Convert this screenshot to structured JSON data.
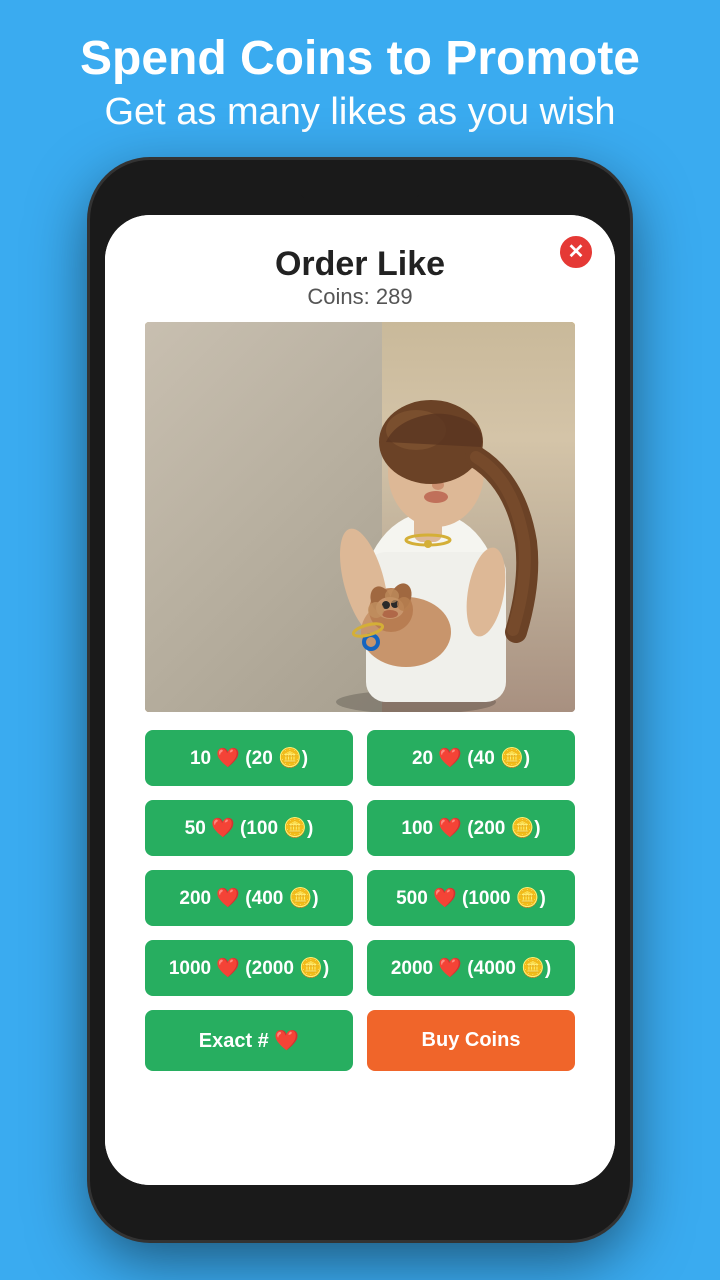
{
  "header": {
    "title": "Spend Coins to Promote",
    "subtitle": "Get as many likes as you wish"
  },
  "modal": {
    "title": "Order Like",
    "coins_label": "Coins: 289",
    "close_label": "✕"
  },
  "order_buttons": [
    {
      "likes": "10",
      "coins": "20",
      "label": "10 ❤️ (20 🪙)"
    },
    {
      "likes": "20",
      "coins": "40",
      "label": "20 ❤️ (40 🪙)"
    },
    {
      "likes": "50",
      "coins": "100",
      "label": "50 ❤️ (100 🪙)"
    },
    {
      "likes": "100",
      "coins": "200",
      "label": "100 ❤️ (200 🪙)"
    },
    {
      "likes": "200",
      "coins": "400",
      "label": "200 ❤️ (400 🪙)"
    },
    {
      "likes": "500",
      "coins": "1000",
      "label": "500 ❤️ (1000 🪙)"
    },
    {
      "likes": "1000",
      "coins": "2000",
      "label": "1000 ❤️ (2000 🪙)"
    },
    {
      "likes": "2000",
      "coins": "4000",
      "label": "2000 ❤️ (4000 🪙)"
    }
  ],
  "bottom_buttons": {
    "exact_label": "Exact  # ❤️",
    "buy_label": "Buy  Coins"
  },
  "colors": {
    "background": "#3aabf0",
    "green": "#27ae60",
    "orange": "#f0652a",
    "close_red": "#e53935"
  }
}
